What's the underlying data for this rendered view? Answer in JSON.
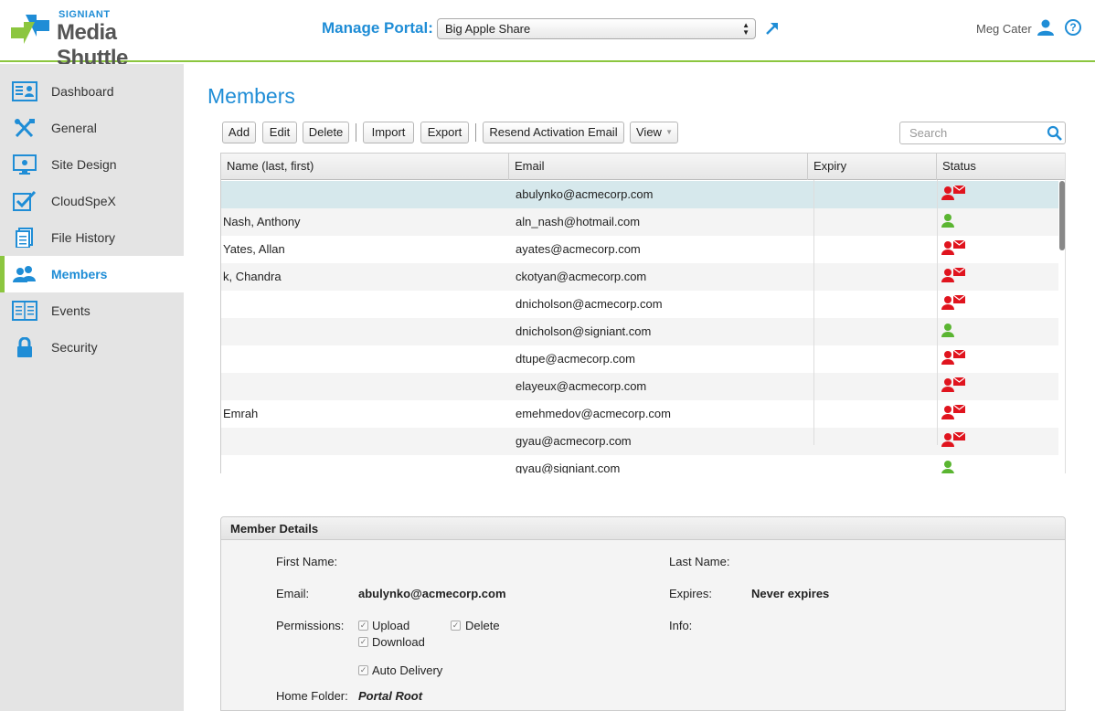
{
  "header": {
    "brand": "SIGNIANT",
    "product": "Media Shuttle",
    "manage_label": "Manage Portal:",
    "portal_selected": "Big Apple Share",
    "user_name": "Meg Cater",
    "help_glyph": "?"
  },
  "sidebar": {
    "items": [
      {
        "label": "Dashboard",
        "icon": "dashboard-icon"
      },
      {
        "label": "General",
        "icon": "tools-icon"
      },
      {
        "label": "Site Design",
        "icon": "monitor-icon"
      },
      {
        "label": "CloudSpeX",
        "icon": "checkbox-icon"
      },
      {
        "label": "File History",
        "icon": "document-icon"
      },
      {
        "label": "Members",
        "icon": "members-icon",
        "active": true
      },
      {
        "label": "Events",
        "icon": "list-icon"
      },
      {
        "label": "Security",
        "icon": "lock-icon"
      }
    ]
  },
  "main": {
    "title": "Members",
    "toolbar": {
      "add": "Add",
      "edit": "Edit",
      "delete": "Delete",
      "import": "Import",
      "export": "Export",
      "resend": "Resend Activation Email",
      "view": "View"
    },
    "search_placeholder": "Search"
  },
  "table": {
    "columns": [
      "Name (last, first)",
      "Email",
      "Expiry",
      "Status"
    ],
    "rows": [
      {
        "name": "",
        "email": "abulynko@acmecorp.com",
        "expiry": "",
        "status": "pending"
      },
      {
        "name": "Nash, Anthony",
        "email": "aln_nash@hotmail.com",
        "expiry": "",
        "status": "active"
      },
      {
        "name": "Yates, Allan",
        "email": "ayates@acmecorp.com",
        "expiry": "",
        "status": "pending"
      },
      {
        "name": "k, Chandra",
        "email": "ckotyan@acmecorp.com",
        "expiry": "",
        "status": "pending"
      },
      {
        "name": "",
        "email": "dnicholson@acmecorp.com",
        "expiry": "",
        "status": "pending"
      },
      {
        "name": "",
        "email": "dnicholson@signiant.com",
        "expiry": "",
        "status": "active"
      },
      {
        "name": "",
        "email": "dtupe@acmecorp.com",
        "expiry": "",
        "status": "pending"
      },
      {
        "name": "",
        "email": "elayeux@acmecorp.com",
        "expiry": "",
        "status": "pending"
      },
      {
        "name": "Emrah",
        "email": "emehmedov@acmecorp.com",
        "expiry": "",
        "status": "pending"
      },
      {
        "name": "",
        "email": "gyau@acmecorp.com",
        "expiry": "",
        "status": "pending"
      },
      {
        "name": "",
        "email": "gyau@signiant.com",
        "expiry": "",
        "status": "active"
      }
    ],
    "selected_row": 0
  },
  "details": {
    "title": "Member Details",
    "first_name_label": "First Name:",
    "first_name_value": "",
    "last_name_label": "Last Name:",
    "last_name_value": "",
    "email_label": "Email:",
    "email_value": "abulynko@acmecorp.com",
    "expires_label": "Expires:",
    "expires_value": "Never expires",
    "permissions_label": "Permissions:",
    "perm_upload": "Upload",
    "perm_delete": "Delete",
    "perm_download": "Download",
    "perm_auto_delivery": "Auto Delivery",
    "info_label": "Info:",
    "home_folder_label": "Home Folder:",
    "home_folder_value": "Portal Root"
  },
  "colors": {
    "accent_blue": "#1f8dd6",
    "accent_green": "#8cc63f",
    "status_pending": "#e0141e",
    "status_active": "#5ab531"
  }
}
